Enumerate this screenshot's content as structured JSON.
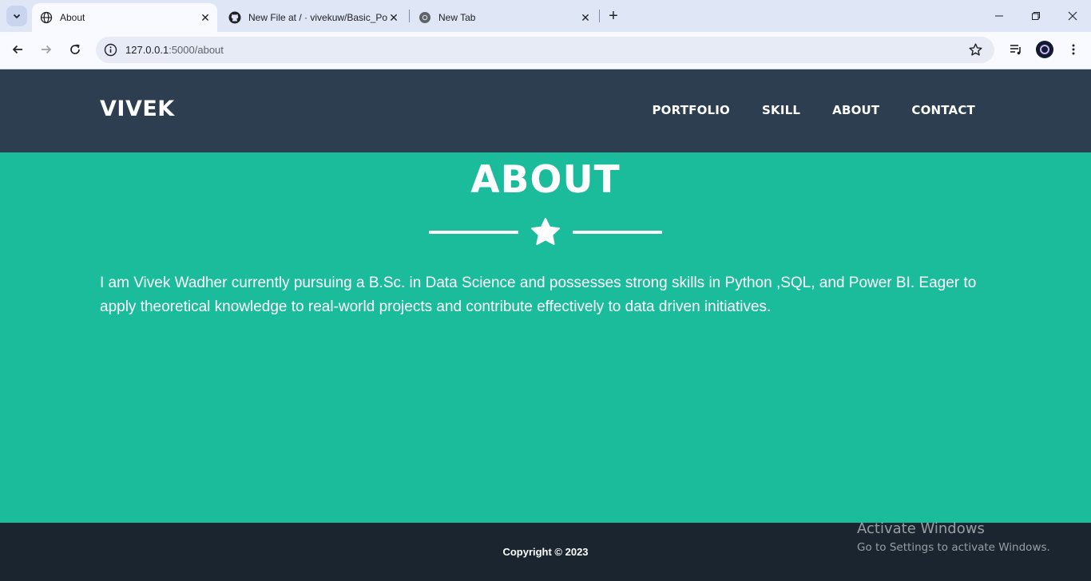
{
  "browser": {
    "tabs": [
      {
        "title": "About",
        "icon": "globe-icon",
        "active": true
      },
      {
        "title": "New File at / · vivekuw/Basic_Po",
        "icon": "github-icon",
        "active": false
      },
      {
        "title": "New Tab",
        "icon": "chrome-icon",
        "active": false
      }
    ],
    "url_host": "127.0.0.1",
    "url_path": ":5000/about"
  },
  "header": {
    "brand": "VIVEK",
    "nav": [
      "PORTFOLIO",
      "SKILL",
      "ABOUT",
      "CONTACT"
    ]
  },
  "about": {
    "title": "ABOUT",
    "text": "I am Vivek Wadher currently pursuing a B.Sc. in Data Science and possesses strong skills in Python ,SQL, and Power BI. Eager to apply theoretical knowledge to real-world projects and contribute effectively to data driven initiatives."
  },
  "footer": {
    "copyright": "Copyright © 2023"
  },
  "watermark": {
    "title": "Activate Windows",
    "subtitle": "Go to Settings to activate Windows."
  },
  "colors": {
    "header_bg": "#2c3e50",
    "section_bg": "#1abc9c",
    "footer_bg": "#1a252f"
  }
}
